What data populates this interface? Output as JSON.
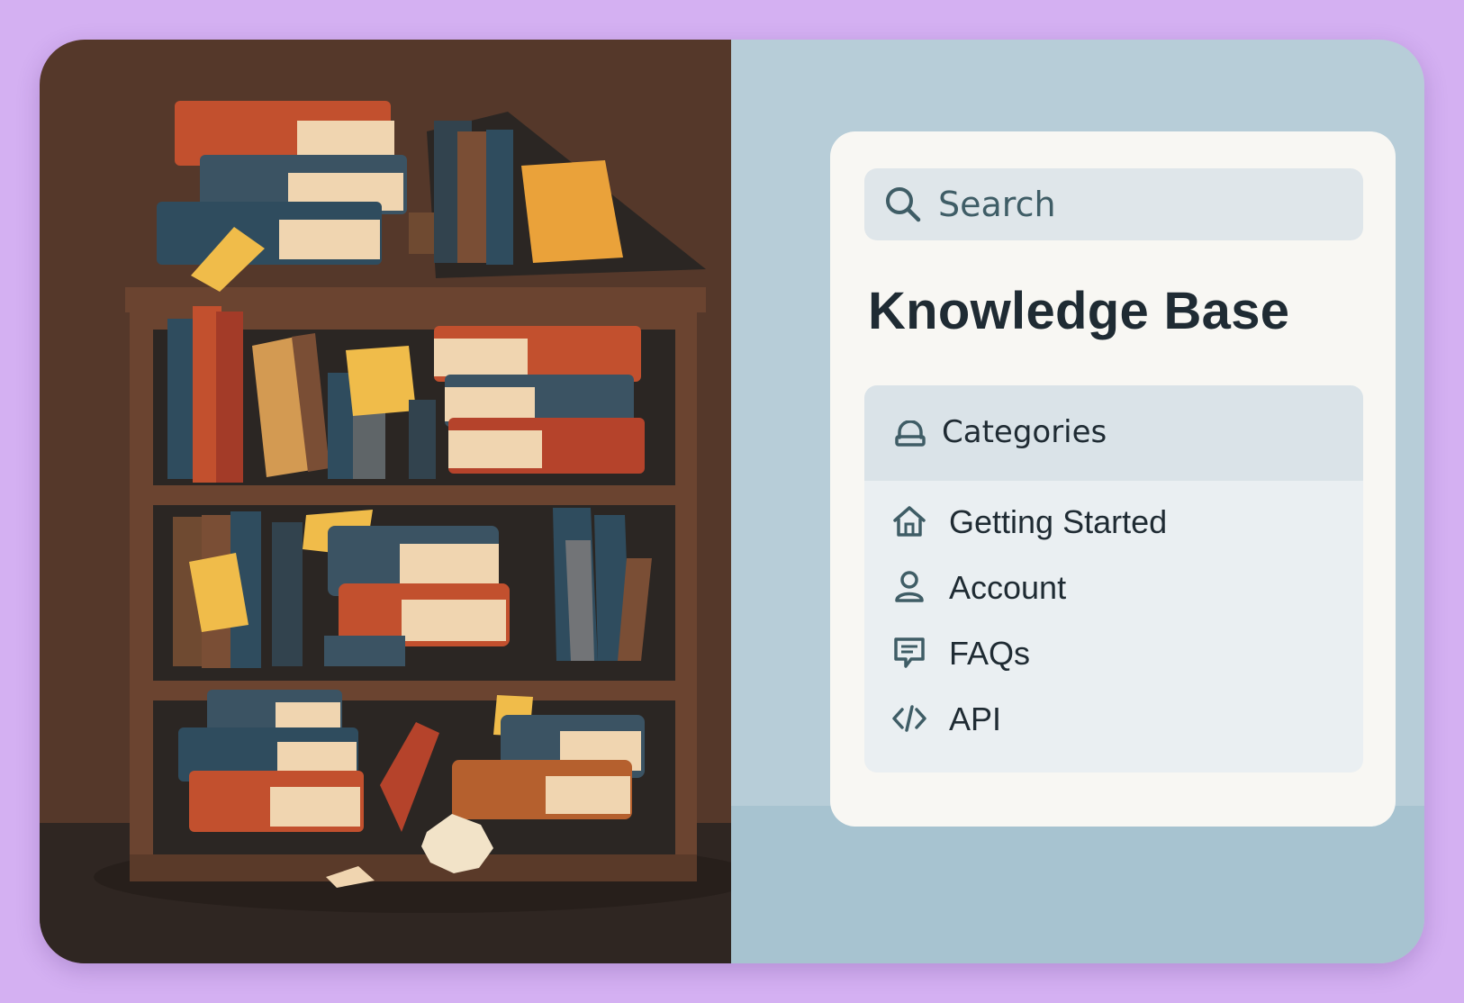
{
  "search": {
    "placeholder": "Search",
    "icon": "search-icon"
  },
  "page_title": "Knowledge Base",
  "categories": {
    "header_label": "Categories",
    "header_icon": "categories-icon",
    "items": [
      {
        "label": "Getting Started",
        "icon": "home-icon"
      },
      {
        "label": "Account",
        "icon": "user-icon"
      },
      {
        "label": "FAQs",
        "icon": "chat-bubble-icon"
      },
      {
        "label": "API",
        "icon": "code-icon"
      }
    ]
  },
  "illustration": {
    "subject": "cluttered bookshelf"
  },
  "colors": {
    "page_background": "#d4b0f2",
    "left_wall": "#55382a",
    "right_panel": "#b7cdd8",
    "card": "#f8f7f3",
    "text": "#1f2b33",
    "accent_icon": "#3f5d66"
  }
}
